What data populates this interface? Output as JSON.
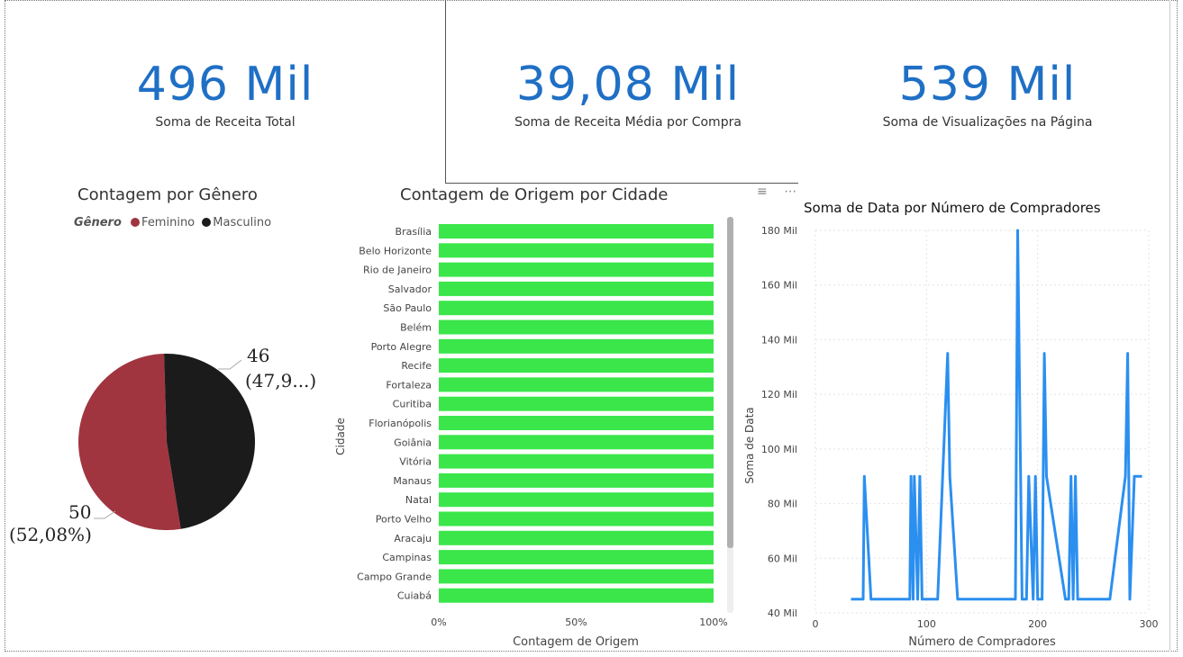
{
  "kpis": [
    {
      "value": "496 Mil",
      "label": "Soma de Receita Total"
    },
    {
      "value": "39,08 Mil",
      "label": "Soma de Receita Média por Compra"
    },
    {
      "value": "539 Mil",
      "label": "Soma de Visualizações na Página"
    }
  ],
  "gender_chart": {
    "title": "Contagem por Gênero",
    "legend_title": "Gênero",
    "legend_items": [
      {
        "label": "Feminino",
        "color": "#a03540"
      },
      {
        "label": "Masculino",
        "color": "#1b1b1b"
      }
    ],
    "label_masc_value": "46",
    "label_masc_pct": "(47,9...)",
    "label_fem_value": "50",
    "label_fem_pct": "(52,08%)"
  },
  "city_chart": {
    "title": "Contagem de Origem por Cidade",
    "ylabel": "Cidade",
    "xlabel": "Contagem de Origem",
    "bar_color": "#3ae64a",
    "xticks": [
      "0%",
      "50%",
      "100%"
    ]
  },
  "line_chart_title": "Soma de Data por Número de Compradores",
  "chart_data": [
    {
      "type": "pie",
      "title": "Contagem por Gênero",
      "categories": [
        "Feminino",
        "Masculino"
      ],
      "values": [
        50,
        46
      ],
      "percentages": [
        52.08,
        47.92
      ]
    },
    {
      "type": "bar",
      "title": "Contagem de Origem por Cidade",
      "orientation": "horizontal",
      "categories": [
        "Brasília",
        "Belo Horizonte",
        "Rio de Janeiro",
        "Salvador",
        "São Paulo",
        "Belém",
        "Porto Alegre",
        "Recife",
        "Fortaleza",
        "Curitiba",
        "Florianópolis",
        "Goiânia",
        "Vitória",
        "Manaus",
        "Natal",
        "Porto Velho",
        "Aracaju",
        "Campinas",
        "Campo Grande",
        "Cuiabá"
      ],
      "values": [
        100,
        100,
        100,
        100,
        100,
        100,
        100,
        100,
        100,
        100,
        100,
        100,
        100,
        100,
        100,
        100,
        100,
        100,
        100,
        100
      ],
      "xlabel": "Contagem de Origem",
      "ylabel": "Cidade",
      "xlim": [
        0,
        100
      ],
      "xtick_labels": [
        "0%",
        "50%",
        "100%"
      ]
    },
    {
      "type": "line",
      "title": "Soma de Data por Número de Compradores",
      "xlabel": "Número de Compradores",
      "ylabel": "Soma de Data",
      "xlim": [
        0,
        300
      ],
      "ylim": [
        40000,
        180000
      ],
      "xticks": [
        0,
        100,
        200,
        300
      ],
      "yticks": [
        40000,
        60000,
        80000,
        100000,
        120000,
        140000,
        160000,
        180000
      ],
      "ytick_labels": [
        "40 Mil",
        "60 Mil",
        "80 Mil",
        "100 Mil",
        "120 Mil",
        "140 Mil",
        "160 Mil",
        "180 Mil"
      ],
      "xtick_labels": [
        "0",
        "100",
        "200",
        "300"
      ],
      "color": "#2b8ff0",
      "x": [
        32,
        43,
        44,
        50,
        85,
        86,
        88,
        89,
        92,
        94,
        96,
        110,
        119,
        121,
        128,
        180,
        182,
        186,
        190,
        192,
        196,
        198,
        200,
        204,
        206,
        208,
        225,
        228,
        230,
        232,
        234,
        236,
        240,
        265,
        279,
        281,
        283,
        287,
        294
      ],
      "y": [
        45000,
        45000,
        90000,
        45000,
        45000,
        90000,
        45000,
        90000,
        45000,
        90000,
        45000,
        45000,
        135000,
        90000,
        45000,
        45000,
        180000,
        45000,
        45000,
        90000,
        45000,
        90000,
        45000,
        45000,
        135000,
        90000,
        45000,
        45000,
        90000,
        45000,
        90000,
        45000,
        45000,
        45000,
        90000,
        135000,
        45000,
        90000,
        90000
      ]
    }
  ]
}
